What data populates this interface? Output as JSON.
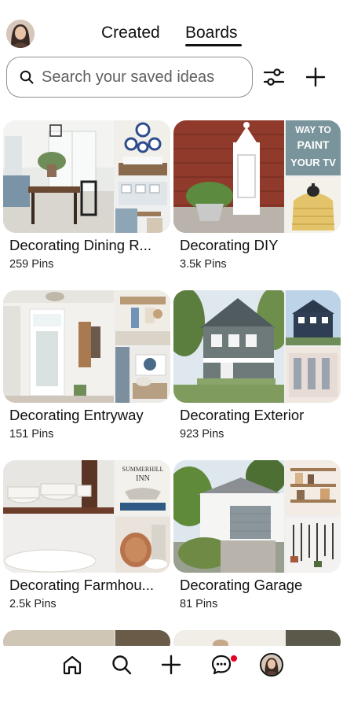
{
  "header": {
    "tabs": [
      {
        "label": "Created",
        "active": false
      },
      {
        "label": "Boards",
        "active": true
      }
    ]
  },
  "search": {
    "placeholder": "Search your saved ideas",
    "icon": "search-icon"
  },
  "toolbar": {
    "filter_icon": "sliders-icon",
    "add_icon": "plus-icon"
  },
  "boards": [
    {
      "title": "Decorating Dining R...",
      "count": "259 Pins"
    },
    {
      "title": "Decorating DIY",
      "count": "3.5k Pins"
    },
    {
      "title": "Decorating Entryway",
      "count": "151 Pins"
    },
    {
      "title": "Decorating Exterior",
      "count": "923 Pins"
    },
    {
      "title": "Decorating Farmhou...",
      "count": "2.5k Pins"
    },
    {
      "title": "Decorating Garage",
      "count": "81 Pins"
    }
  ],
  "thumbnail_text": {
    "diy_overlay": "WAY TO PAINT YOUR TV",
    "farmhouse_sign": "SUMMERHILL INN"
  },
  "bottom_nav": {
    "items": [
      "home-icon",
      "search-icon",
      "plus-icon",
      "messages-icon",
      "profile-avatar"
    ],
    "messages_notification": true
  },
  "colors": {
    "accent_notification": "#e60023",
    "text_primary": "#111111",
    "search_border": "#8f8f8f"
  }
}
